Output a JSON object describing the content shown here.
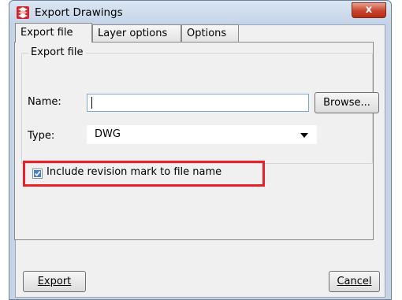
{
  "window": {
    "title": "Export Drawings",
    "close_label": "x",
    "app_icon": "tekla-app-icon"
  },
  "tabs": [
    {
      "label": "Export file"
    },
    {
      "label": "Layer options"
    },
    {
      "label": "Options"
    }
  ],
  "export_file_group": {
    "title": "Export file",
    "name_label": "Name:",
    "name_value": "",
    "browse_label": "Browse...",
    "type_label": "Type:",
    "type_value": "DWG",
    "include_revision_label": "Include revision mark to file name",
    "include_revision_checked": true
  },
  "footer": {
    "export_label": "Export",
    "cancel_label": "Cancel"
  },
  "colors": {
    "highlight": "#e8202a",
    "title_bar": "#c6d4e6"
  }
}
